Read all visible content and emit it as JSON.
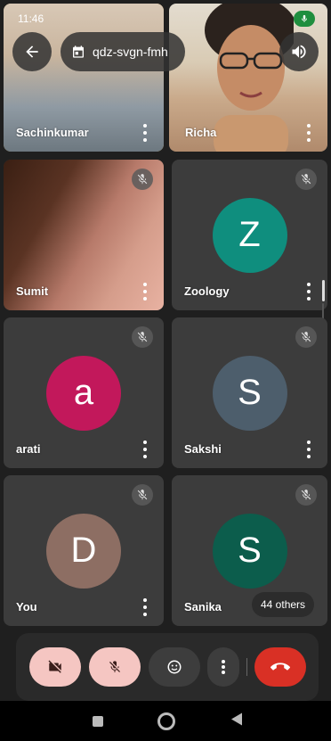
{
  "status": {
    "time": "11:46"
  },
  "meeting": {
    "code": "qdz-svgn-fmh"
  },
  "participants": [
    {
      "name": "Sachinkumar"
    },
    {
      "name": "Richa"
    },
    {
      "name": "Sumit"
    },
    {
      "name": "Zoology",
      "initial": "Z",
      "color": "#0f8e7e"
    },
    {
      "name": "arati",
      "initial": "a",
      "color": "#c2185b"
    },
    {
      "name": "Sakshi",
      "initial": "S",
      "color": "#4d5e6c"
    },
    {
      "name": "You",
      "initial": "D",
      "color": "#8d6e63"
    },
    {
      "name": "Sanika",
      "initial": "S",
      "color": "#0c5d4c"
    }
  ],
  "others_label": "44 others",
  "icons": {
    "back": "back-arrow-icon",
    "calendar": "calendar-icon",
    "speaker": "speaker-icon",
    "mic_active": "mic-active-icon",
    "mic_off": "mic-off-icon",
    "cam_off": "camera-off-icon",
    "emoji": "emoji-icon",
    "more": "more-vertical-icon",
    "hangup": "hang-up-icon"
  },
  "colors": {
    "background": "#1f1f1f",
    "tile": "#3c3c3c",
    "control_off": "#f5c6c2",
    "hangup": "#d93025",
    "mic_active": "#1e8e3e"
  }
}
